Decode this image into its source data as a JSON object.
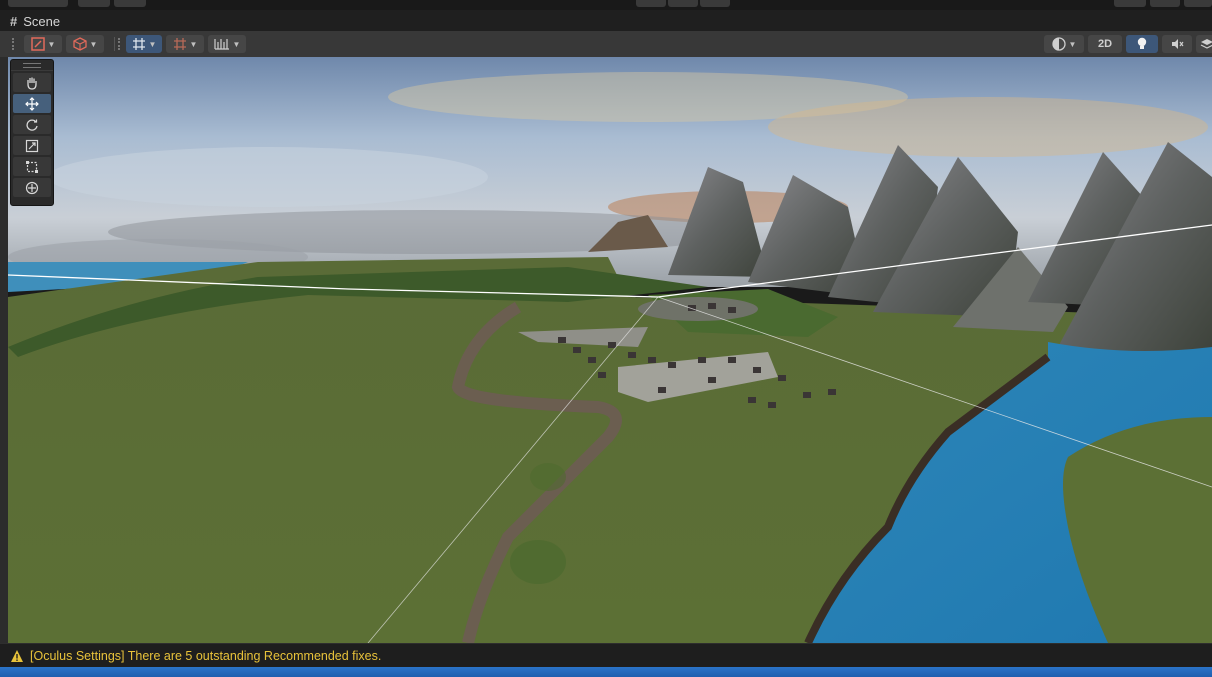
{
  "window": {
    "top_buttons": [
      "play-icon",
      "pause-icon",
      "step-icon"
    ]
  },
  "scene_tab": {
    "icon": "grid-hash-icon",
    "label": "Scene"
  },
  "toolbar": {
    "left_tools": [
      {
        "name": "gizmo-tool-context-icon"
      },
      {
        "name": "draw-mode-cube-icon"
      },
      {
        "name": "grid-snapping-icon",
        "active": true
      },
      {
        "name": "increment-snap-icon"
      },
      {
        "name": "ruler-snap-icon"
      }
    ],
    "right": {
      "shading_icon": "shading-sphere-icon",
      "toggle_2d": "2D",
      "lighting_icon": "lightbulb-icon",
      "audio_icon": "audio-mute-icon",
      "effects_icon": "layers-icon"
    }
  },
  "tool_palette": [
    {
      "name": "hand-tool-icon"
    },
    {
      "name": "move-tool-icon",
      "selected": true
    },
    {
      "name": "rotate-tool-icon"
    },
    {
      "name": "scale-tool-icon"
    },
    {
      "name": "rect-tool-icon"
    },
    {
      "name": "transform-tool-icon"
    }
  ],
  "status_bar": {
    "icon": "warning-icon",
    "message": "[Oculus Settings] There are 5 outstanding Recommended fixes."
  },
  "colors": {
    "accent": "#3d5779",
    "warning": "#e8c23a",
    "terrain": "#5e7236",
    "water": "#2f8fc2"
  }
}
